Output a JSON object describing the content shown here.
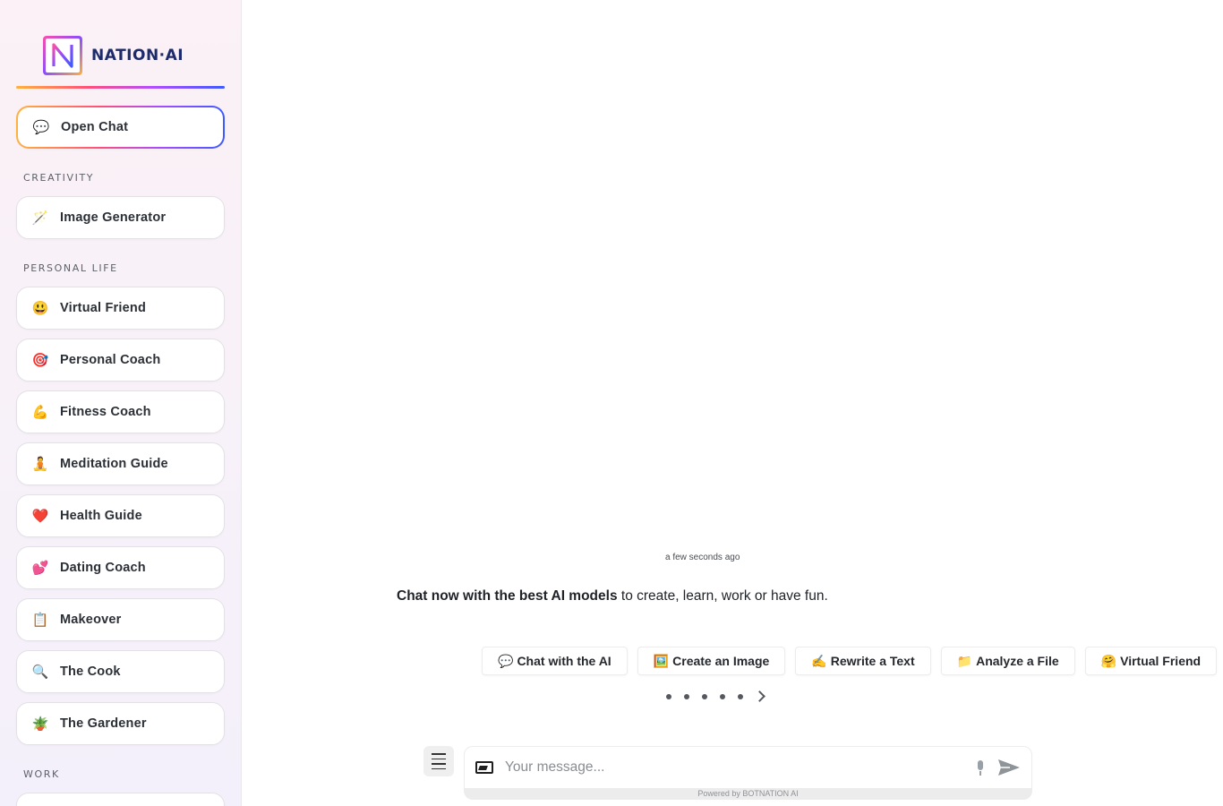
{
  "brand": {
    "name": "NATION·AI",
    "logo_letter": "N"
  },
  "sidebar": {
    "open_chat": {
      "label": "Open Chat",
      "icon": "speech-bubble-icon",
      "glyph": "💬"
    },
    "sections": {
      "creativity": "CREATIVITY",
      "personal_life": "PERSONAL LIFE",
      "work": "WORK"
    },
    "creativity_items": [
      {
        "label": "Image Generator",
        "icon": "magic-wand-icon",
        "glyph": "🪄"
      }
    ],
    "personal_items": [
      {
        "label": "Virtual Friend",
        "icon": "smiley-icon",
        "glyph": "😃"
      },
      {
        "label": "Personal Coach",
        "icon": "target-icon",
        "glyph": "🎯"
      },
      {
        "label": "Fitness Coach",
        "icon": "flexed-biceps-icon",
        "glyph": "💪"
      },
      {
        "label": "Meditation Guide",
        "icon": "meditation-icon",
        "glyph": "🧘"
      },
      {
        "label": "Health Guide",
        "icon": "heart-health-icon",
        "glyph": "❤️"
      },
      {
        "label": "Dating Coach",
        "icon": "two-hearts-icon",
        "glyph": "💕"
      },
      {
        "label": "Makeover",
        "icon": "clipboard-icon",
        "glyph": "📋"
      },
      {
        "label": "The Cook",
        "icon": "magnifier-icon",
        "glyph": "🔍"
      },
      {
        "label": "The Gardener",
        "icon": "potted-plant-icon",
        "glyph": "🪴"
      }
    ]
  },
  "chat": {
    "timestamp": "a few seconds ago",
    "welcome_bold": "Chat now with the best AI models",
    "welcome_rest": " to create, learn, work or have fun."
  },
  "suggestions": [
    {
      "label": "Chat with the AI",
      "glyph": "💬"
    },
    {
      "label": "Create an Image",
      "glyph": "🖼️"
    },
    {
      "label": "Rewrite a Text",
      "glyph": "✍️"
    },
    {
      "label": "Analyze a File",
      "glyph": "📁"
    },
    {
      "label": "Virtual Friend",
      "glyph": "🤗"
    }
  ],
  "composer": {
    "placeholder": "Your message...",
    "powered_by": "Powered by BOTNATION AI"
  },
  "colors": {
    "brand_navy": "#1d2a6b",
    "gradient_orange": "#ffb23e",
    "gradient_pink": "#ff4f7b",
    "gradient_purple": "#a24dff",
    "gradient_blue": "#3d5bff"
  }
}
